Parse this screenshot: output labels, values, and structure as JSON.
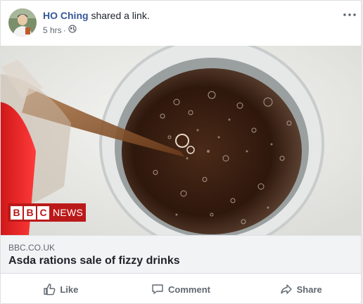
{
  "post": {
    "author": "HO Ching",
    "action_text": "shared a link.",
    "time": "5 hrs",
    "separator": "·",
    "privacy_icon": "globe-icon",
    "more_icon": "more-options-icon"
  },
  "media": {
    "badge_blocks": [
      "B",
      "B",
      "C"
    ],
    "badge_word": "NEWS",
    "colors": {
      "badge_red": "#bb1919",
      "cola": "#3a1f12"
    }
  },
  "link": {
    "domain": "BBC.CO.UK",
    "title": "Asda rations sale of fizzy drinks"
  },
  "actions": {
    "like": "Like",
    "comment": "Comment",
    "share": "Share"
  },
  "colors": {
    "author_link": "#365899",
    "action_gray": "#606770"
  }
}
